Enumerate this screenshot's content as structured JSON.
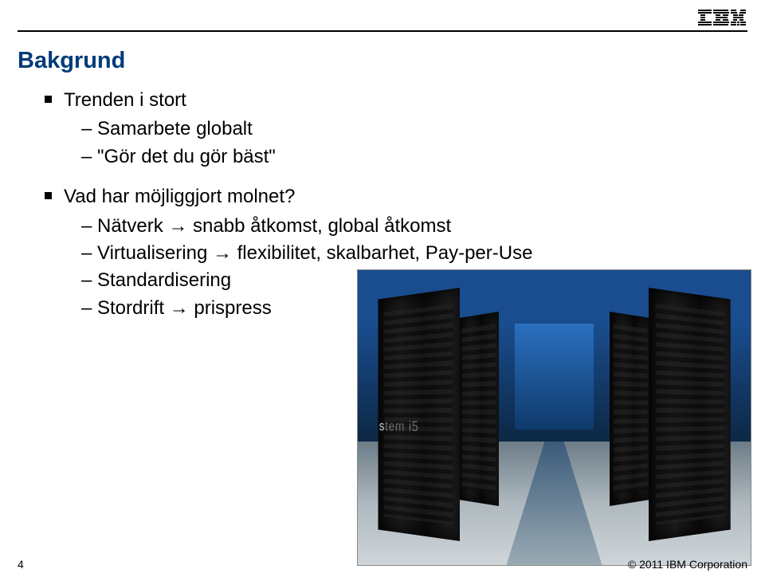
{
  "brand": "IBM",
  "title": "Bakgrund",
  "bullets": [
    {
      "heading": "Trenden i stort",
      "items": [
        "Samarbete globalt",
        "\"Gör det du gör bäst\""
      ]
    },
    {
      "heading": "Vad har möjliggjort molnet?",
      "items": [
        "Nätverk → snabb åtkomst, global åtkomst",
        "Virtualisering → flexibilitet, skalbarhet, Pay-per-Use",
        "Standardisering",
        "Stordrift → prispress"
      ]
    }
  ],
  "image_label": "stem i5",
  "footer": {
    "page": "4",
    "copyright": "© 2011 IBM Corporation"
  }
}
